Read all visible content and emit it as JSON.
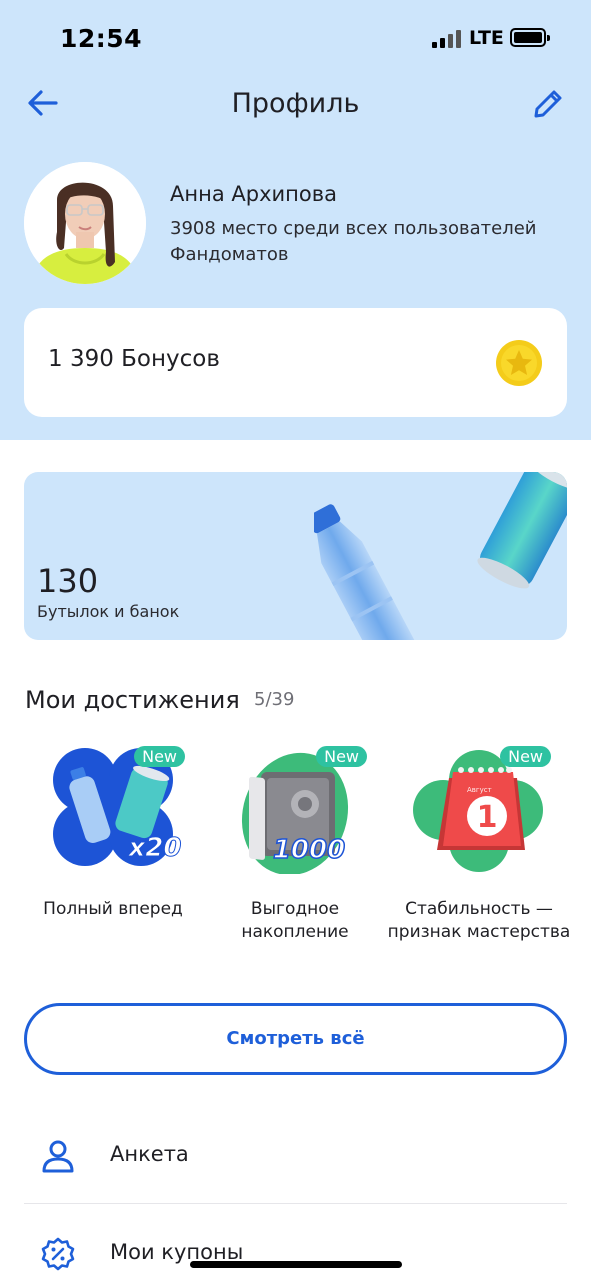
{
  "status_bar": {
    "time": "12:54",
    "network": "LTE"
  },
  "header": {
    "title": "Профиль",
    "back_icon": "arrow-left-icon",
    "edit_icon": "pencil-icon"
  },
  "profile": {
    "name": "Анна Архипова",
    "rank_text": "3908 место среди всех пользователей Фандоматов"
  },
  "bonuses": {
    "label": "1 390 Бонусов",
    "icon": "coin-icon"
  },
  "bottles": {
    "count": "130",
    "label": "Бутылок и банок"
  },
  "achievements": {
    "heading": "Мои достижения",
    "progress": "5/39",
    "items": [
      {
        "title": "Полный вперед",
        "badge": "New",
        "icon_text": "x20"
      },
      {
        "title": "Выгодное накопление",
        "badge": "New",
        "icon_text": "1000"
      },
      {
        "title": "Стабильность — признак мастерства",
        "badge": "New",
        "icon_text": "1",
        "icon_subtext": "Август"
      }
    ],
    "see_all": "Смотреть всё"
  },
  "menu": [
    {
      "label": "Анкета",
      "icon": "user-icon"
    },
    {
      "label": "Мои купоны",
      "icon": "discount-badge-icon"
    }
  ],
  "colors": {
    "accent": "#1e5fd9",
    "header_bg": "#cde5fb",
    "badge": "#2ec2a1"
  }
}
